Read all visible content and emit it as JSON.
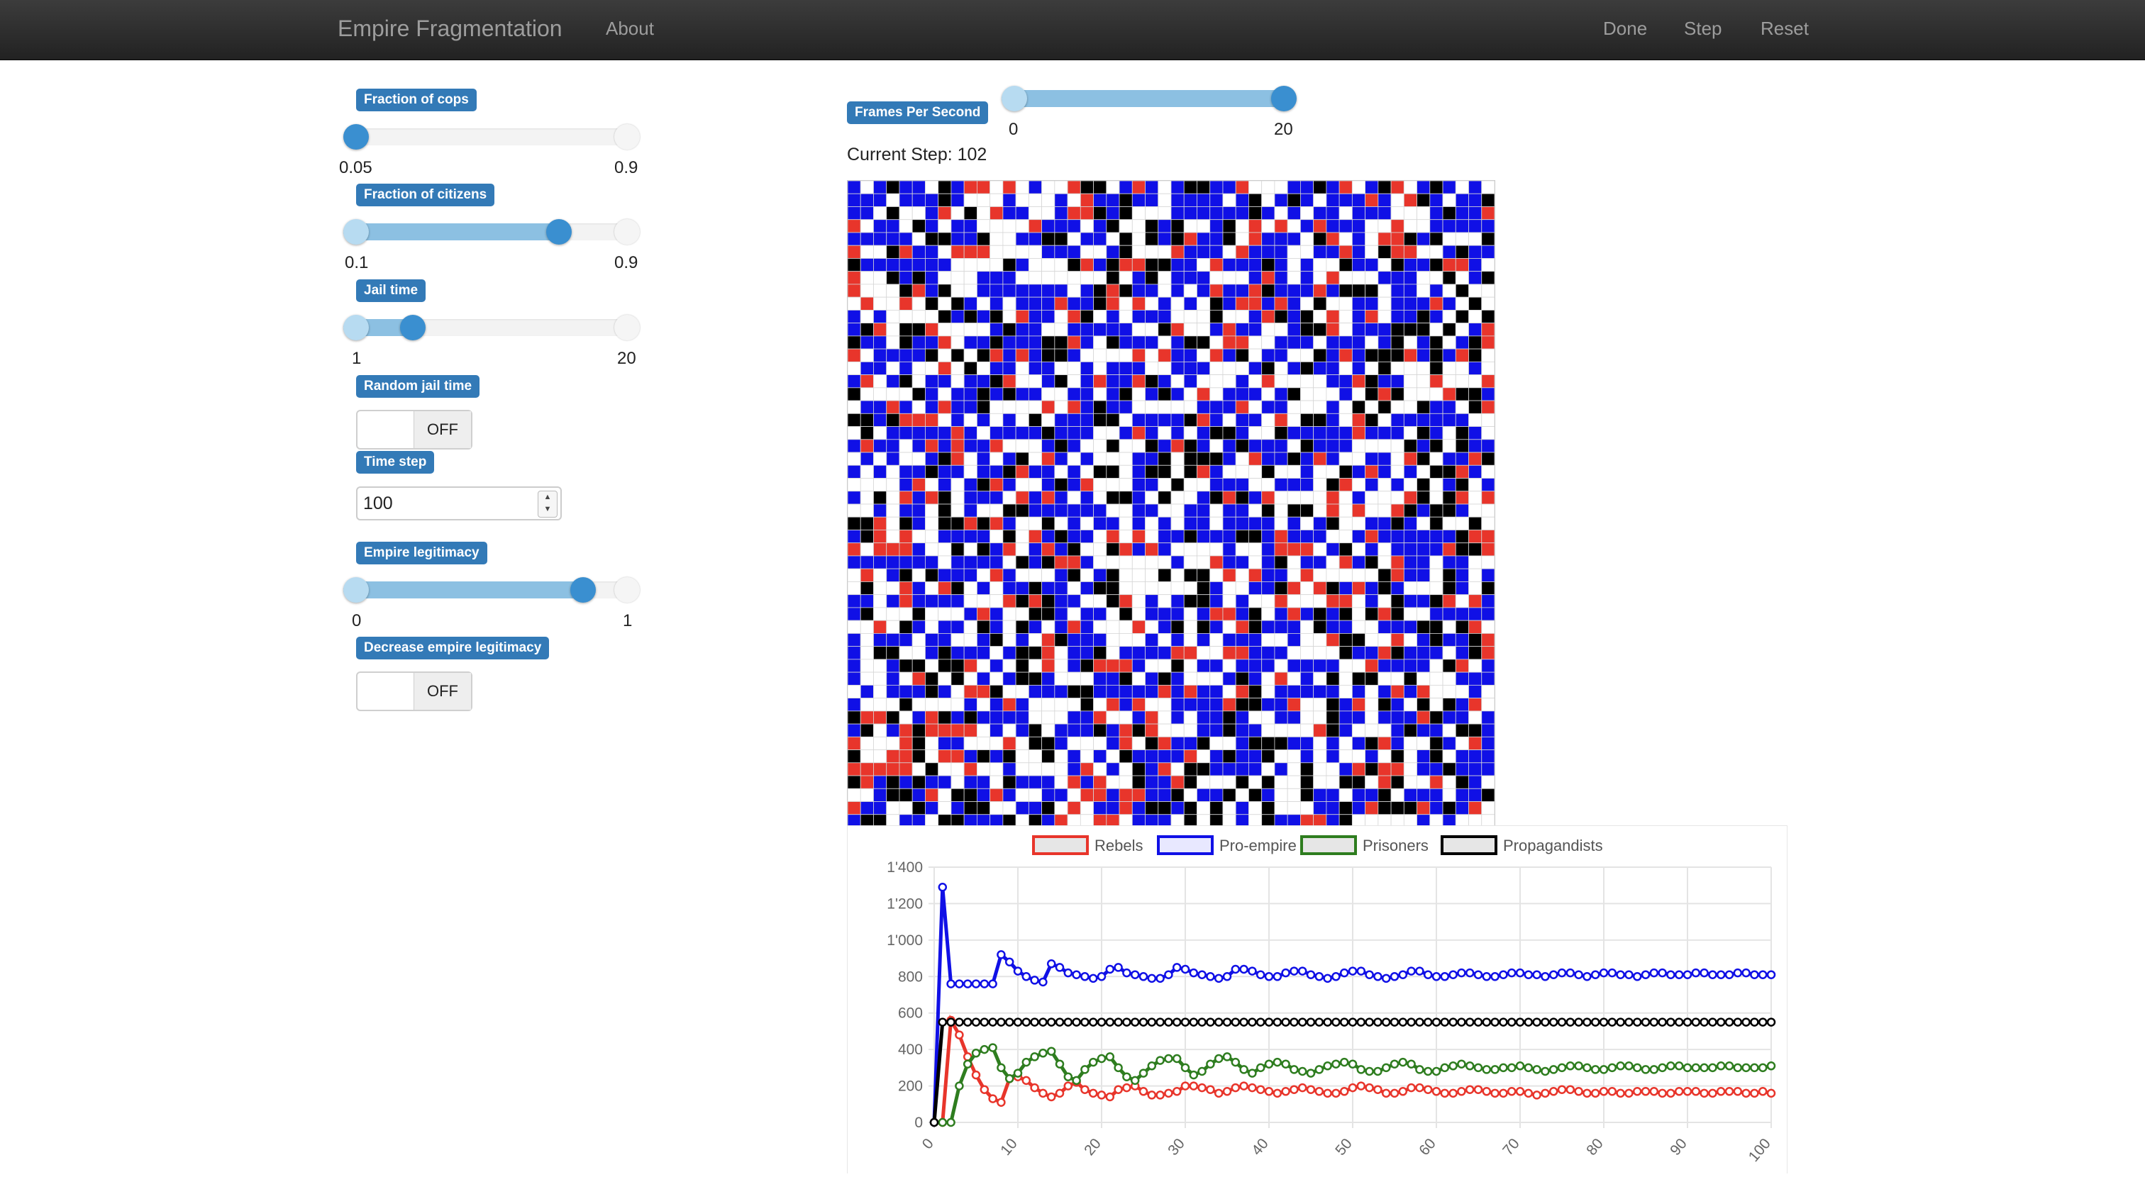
{
  "navbar": {
    "brand": "Empire Fragmentation",
    "about": "About",
    "done": "Done",
    "step": "Step",
    "reset": "Reset"
  },
  "params": {
    "cops": {
      "label": "Fraction of cops",
      "min": "0.05",
      "max": "0.9",
      "value": 0.05
    },
    "citizens": {
      "label": "Fraction of citizens",
      "min": "0.1",
      "max": "0.9",
      "value": 0.75
    },
    "jail": {
      "label": "Jail time",
      "min": "1",
      "max": "20",
      "value": 4
    },
    "random_jail": {
      "label": "Random jail time",
      "state": "OFF"
    },
    "time_step": {
      "label": "Time step",
      "value": "100"
    },
    "legitimacy": {
      "label": "Empire legitimacy",
      "min": "0",
      "max": "1",
      "value": 0.84
    },
    "decrease_legitimacy": {
      "label": "Decrease empire legitimacy",
      "state": "OFF"
    }
  },
  "fps": {
    "label": "Frames Per Second",
    "min": "0",
    "max": "20",
    "value": 20
  },
  "current_step": "Current Step: 102",
  "colors": {
    "rebels": "#e8352b",
    "pro_empire": "#1010e6",
    "prisoners": "#2e7d1f",
    "propagandists": "#000000",
    "accent": "#337ab7"
  },
  "grid": {
    "size": 50,
    "cell_colors": [
      "#ffffff",
      "#1010e6",
      "#e8352b",
      "#000000"
    ]
  },
  "chart_data": {
    "type": "line",
    "legend": [
      "Rebels",
      "Pro-empire",
      "Prisoners",
      "Propagandists"
    ],
    "ylim": [
      0,
      1400
    ],
    "yticks": [
      "0",
      "200",
      "400",
      "600",
      "800",
      "1'000",
      "1'200",
      "1'400"
    ],
    "xlim": [
      0,
      100
    ],
    "xticks": [
      "0",
      "10",
      "20",
      "30",
      "40",
      "50",
      "60",
      "70",
      "80",
      "90",
      "100"
    ],
    "x": [
      0,
      1,
      2,
      3,
      4,
      5,
      6,
      7,
      8,
      9,
      10,
      11,
      12,
      13,
      14,
      15,
      16,
      17,
      18,
      19,
      20,
      21,
      22,
      23,
      24,
      25,
      26,
      27,
      28,
      29,
      30,
      31,
      32,
      33,
      34,
      35,
      36,
      37,
      38,
      39,
      40,
      41,
      42,
      43,
      44,
      45,
      46,
      47,
      48,
      49,
      50,
      51,
      52,
      53,
      54,
      55,
      56,
      57,
      58,
      59,
      60,
      61,
      62,
      63,
      64,
      65,
      66,
      67,
      68,
      69,
      70,
      71,
      72,
      73,
      74,
      75,
      76,
      77,
      78,
      79,
      80,
      81,
      82,
      83,
      84,
      85,
      86,
      87,
      88,
      89,
      90,
      91,
      92,
      93,
      94,
      95,
      96,
      97,
      98,
      99,
      100
    ],
    "series": [
      {
        "name": "Rebels",
        "color": "#e8352b",
        "values": [
          0,
          0,
          560,
          480,
          360,
          260,
          180,
          130,
          110,
          240,
          250,
          230,
          190,
          160,
          140,
          160,
          200,
          220,
          180,
          160,
          150,
          140,
          180,
          190,
          200,
          170,
          150,
          150,
          160,
          170,
          200,
          200,
          190,
          180,
          160,
          170,
          190,
          200,
          190,
          180,
          170,
          160,
          170,
          180,
          190,
          180,
          170,
          160,
          160,
          170,
          190,
          200,
          190,
          180,
          160,
          160,
          170,
          190,
          190,
          180,
          170,
          160,
          160,
          170,
          180,
          180,
          170,
          160,
          160,
          170,
          170,
          160,
          150,
          160,
          170,
          180,
          180,
          170,
          160,
          160,
          170,
          170,
          160,
          160,
          170,
          170,
          170,
          160,
          160,
          170,
          170,
          170,
          160,
          160,
          170,
          170,
          170,
          160,
          160,
          170,
          160
        ]
      },
      {
        "name": "Pro-empire",
        "color": "#1010e6",
        "values": [
          0,
          1290,
          760,
          760,
          760,
          760,
          760,
          760,
          920,
          880,
          830,
          800,
          780,
          770,
          870,
          850,
          820,
          810,
          800,
          790,
          800,
          840,
          850,
          820,
          810,
          800,
          790,
          790,
          810,
          850,
          840,
          820,
          810,
          800,
          790,
          800,
          840,
          840,
          830,
          810,
          800,
          800,
          820,
          830,
          830,
          810,
          800,
          790,
          800,
          820,
          830,
          830,
          810,
          800,
          790,
          800,
          810,
          830,
          830,
          810,
          800,
          800,
          810,
          820,
          820,
          810,
          800,
          800,
          810,
          820,
          820,
          810,
          810,
          800,
          810,
          820,
          820,
          810,
          800,
          810,
          820,
          820,
          810,
          810,
          800,
          810,
          820,
          820,
          810,
          810,
          810,
          820,
          820,
          810,
          810,
          810,
          820,
          820,
          810,
          810,
          810
        ]
      },
      {
        "name": "Prisoners",
        "color": "#2e7d1f",
        "values": [
          0,
          0,
          0,
          200,
          320,
          380,
          400,
          410,
          300,
          240,
          270,
          330,
          360,
          380,
          390,
          320,
          250,
          230,
          290,
          330,
          350,
          360,
          300,
          250,
          230,
          270,
          310,
          340,
          350,
          350,
          300,
          260,
          280,
          320,
          350,
          360,
          330,
          290,
          270,
          300,
          320,
          330,
          320,
          290,
          280,
          270,
          290,
          310,
          320,
          330,
          320,
          290,
          280,
          280,
          300,
          320,
          330,
          320,
          290,
          280,
          280,
          300,
          310,
          320,
          310,
          300,
          290,
          290,
          300,
          300,
          310,
          300,
          290,
          280,
          290,
          300,
          310,
          310,
          300,
          290,
          290,
          300,
          310,
          310,
          300,
          290,
          290,
          300,
          310,
          310,
          300,
          300,
          300,
          300,
          310,
          310,
          300,
          300,
          300,
          300,
          310
        ]
      },
      {
        "name": "Propagandists",
        "color": "#000000",
        "values": [
          0,
          550,
          550,
          550,
          550,
          550,
          550,
          550,
          550,
          550,
          550,
          550,
          550,
          550,
          550,
          550,
          550,
          550,
          550,
          550,
          550,
          550,
          550,
          550,
          550,
          550,
          550,
          550,
          550,
          550,
          550,
          550,
          550,
          550,
          550,
          550,
          550,
          550,
          550,
          550,
          550,
          550,
          550,
          550,
          550,
          550,
          550,
          550,
          550,
          550,
          550,
          550,
          550,
          550,
          550,
          550,
          550,
          550,
          550,
          550,
          550,
          550,
          550,
          550,
          550,
          550,
          550,
          550,
          550,
          550,
          550,
          550,
          550,
          550,
          550,
          550,
          550,
          550,
          550,
          550,
          550,
          550,
          550,
          550,
          550,
          550,
          550,
          550,
          550,
          550,
          550,
          550,
          550,
          550,
          550,
          550,
          550,
          550,
          550,
          550,
          550
        ]
      }
    ],
    "grid": true,
    "legend_position": "top"
  }
}
